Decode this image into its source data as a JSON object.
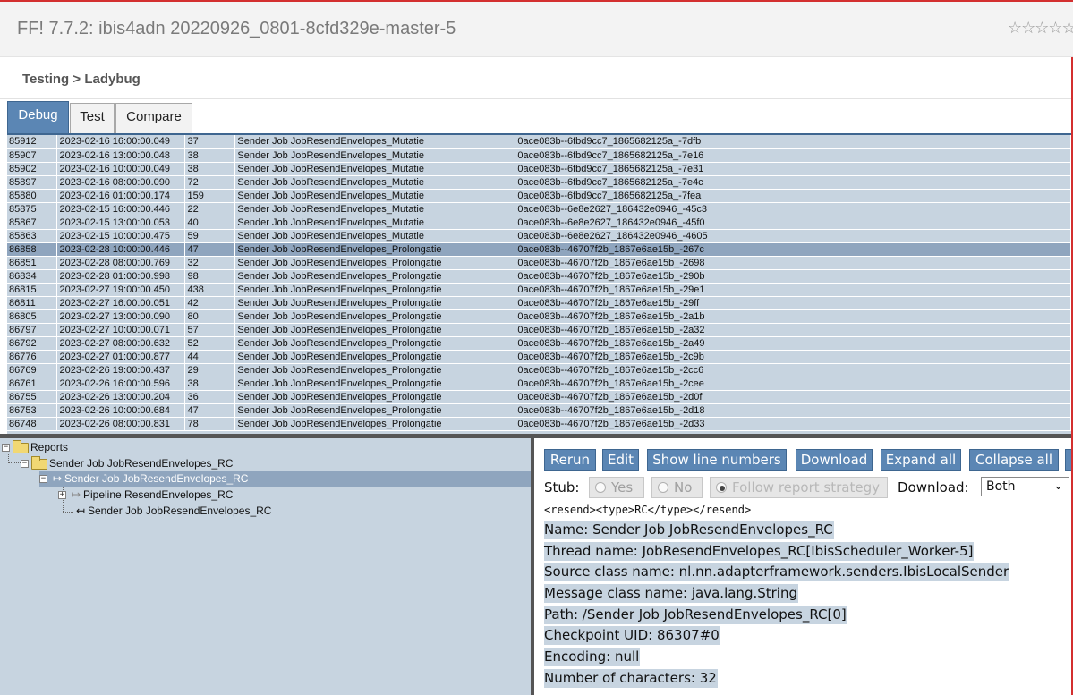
{
  "app": {
    "title": "FF! 7.7.2: ibis4adn 20220926_0801-8cfd329e-master-5",
    "rating_stars": "☆☆☆☆☆"
  },
  "breadcrumb": "Testing > Ladybug",
  "tabs": [
    {
      "label": "Debug",
      "active": true
    },
    {
      "label": "Test",
      "active": false
    },
    {
      "label": "Compare",
      "active": false
    }
  ],
  "reports": {
    "rows": [
      [
        "85912",
        "2023-02-16 16:00:00.049",
        "37",
        "Sender Job JobResendEnvelopes_Mutatie",
        "0ace083b--6fbd9cc7_1865682125a_-7dfb"
      ],
      [
        "85907",
        "2023-02-16 13:00:00.048",
        "38",
        "Sender Job JobResendEnvelopes_Mutatie",
        "0ace083b--6fbd9cc7_1865682125a_-7e16"
      ],
      [
        "85902",
        "2023-02-16 10:00:00.049",
        "38",
        "Sender Job JobResendEnvelopes_Mutatie",
        "0ace083b--6fbd9cc7_1865682125a_-7e31"
      ],
      [
        "85897",
        "2023-02-16 08:00:00.090",
        "72",
        "Sender Job JobResendEnvelopes_Mutatie",
        "0ace083b--6fbd9cc7_1865682125a_-7e4c"
      ],
      [
        "85880",
        "2023-02-16 01:00:00.174",
        "159",
        "Sender Job JobResendEnvelopes_Mutatie",
        "0ace083b--6fbd9cc7_1865682125a_-7fea"
      ],
      [
        "85875",
        "2023-02-15 16:00:00.446",
        "22",
        "Sender Job JobResendEnvelopes_Mutatie",
        "0ace083b--6e8e2627_186432e0946_-45c3"
      ],
      [
        "85867",
        "2023-02-15 13:00:00.053",
        "40",
        "Sender Job JobResendEnvelopes_Mutatie",
        "0ace083b--6e8e2627_186432e0946_-45f0"
      ],
      [
        "85863",
        "2023-02-15 10:00:00.475",
        "59",
        "Sender Job JobResendEnvelopes_Mutatie",
        "0ace083b--6e8e2627_186432e0946_-4605"
      ],
      [
        "86858",
        "2023-02-28 10:00:00.446",
        "47",
        "Sender Job JobResendEnvelopes_Prolongatie",
        "0ace083b--46707f2b_1867e6ae15b_-267c"
      ],
      [
        "86851",
        "2023-02-28 08:00:00.769",
        "32",
        "Sender Job JobResendEnvelopes_Prolongatie",
        "0ace083b--46707f2b_1867e6ae15b_-2698"
      ],
      [
        "86834",
        "2023-02-28 01:00:00.998",
        "98",
        "Sender Job JobResendEnvelopes_Prolongatie",
        "0ace083b--46707f2b_1867e6ae15b_-290b"
      ],
      [
        "86815",
        "2023-02-27 19:00:00.450",
        "438",
        "Sender Job JobResendEnvelopes_Prolongatie",
        "0ace083b--46707f2b_1867e6ae15b_-29e1"
      ],
      [
        "86811",
        "2023-02-27 16:00:00.051",
        "42",
        "Sender Job JobResendEnvelopes_Prolongatie",
        "0ace083b--46707f2b_1867e6ae15b_-29ff"
      ],
      [
        "86805",
        "2023-02-27 13:00:00.090",
        "80",
        "Sender Job JobResendEnvelopes_Prolongatie",
        "0ace083b--46707f2b_1867e6ae15b_-2a1b"
      ],
      [
        "86797",
        "2023-02-27 10:00:00.071",
        "57",
        "Sender Job JobResendEnvelopes_Prolongatie",
        "0ace083b--46707f2b_1867e6ae15b_-2a32"
      ],
      [
        "86792",
        "2023-02-27 08:00:00.632",
        "52",
        "Sender Job JobResendEnvelopes_Prolongatie",
        "0ace083b--46707f2b_1867e6ae15b_-2a49"
      ],
      [
        "86776",
        "2023-02-27 01:00:00.877",
        "44",
        "Sender Job JobResendEnvelopes_Prolongatie",
        "0ace083b--46707f2b_1867e6ae15b_-2c9b"
      ],
      [
        "86769",
        "2023-02-26 19:00:00.437",
        "29",
        "Sender Job JobResendEnvelopes_Prolongatie",
        "0ace083b--46707f2b_1867e6ae15b_-2cc6"
      ],
      [
        "86761",
        "2023-02-26 16:00:00.596",
        "38",
        "Sender Job JobResendEnvelopes_Prolongatie",
        "0ace083b--46707f2b_1867e6ae15b_-2cee"
      ],
      [
        "86755",
        "2023-02-26 13:00:00.204",
        "36",
        "Sender Job JobResendEnvelopes_Prolongatie",
        "0ace083b--46707f2b_1867e6ae15b_-2d0f"
      ],
      [
        "86753",
        "2023-02-26 10:00:00.684",
        "47",
        "Sender Job JobResendEnvelopes_Prolongatie",
        "0ace083b--46707f2b_1867e6ae15b_-2d18"
      ],
      [
        "86748",
        "2023-02-26 08:00:00.831",
        "78",
        "Sender Job JobResendEnvelopes_Prolongatie",
        "0ace083b--46707f2b_1867e6ae15b_-2d33"
      ]
    ],
    "selected_index": 8
  },
  "tree": {
    "root": "Reports",
    "report": "Sender Job JobResendEnvelopes_RC",
    "start": "Sender Job JobResendEnvelopes_RC",
    "pipeline": "Pipeline ResendEnvelopes_RC",
    "end": "Sender Job JobResendEnvelopes_RC"
  },
  "toolbar": {
    "rerun": "Rerun",
    "edit": "Edit",
    "show_line_numbers": "Show line numbers",
    "download": "Download",
    "expand_all": "Expand all",
    "collapse_all": "Collapse all"
  },
  "stub": {
    "label": "Stub:",
    "options": [
      "Yes",
      "No",
      "Follow report strategy"
    ],
    "selected": "Follow report strategy",
    "download_label": "Download:",
    "download_value": "Both"
  },
  "details": {
    "message": "<resend><type>RC</type></resend>",
    "lines": [
      "Name: Sender Job JobResendEnvelopes_RC",
      "Thread name: JobResendEnvelopes_RC[IbisScheduler_Worker-5]",
      "Source class name: nl.nn.adapterframework.senders.IbisLocalSender",
      "Message class name: java.lang.String",
      "Path: /Sender Job JobResendEnvelopes_RC[0]",
      "Checkpoint UID: 86307#0",
      "Encoding: null",
      "Number of characters: 32"
    ]
  },
  "colors": {
    "accent": "#5b86b4",
    "panel": "#c7d4e0",
    "selected": "#8fa5be",
    "top_border": "#d32f2f"
  }
}
